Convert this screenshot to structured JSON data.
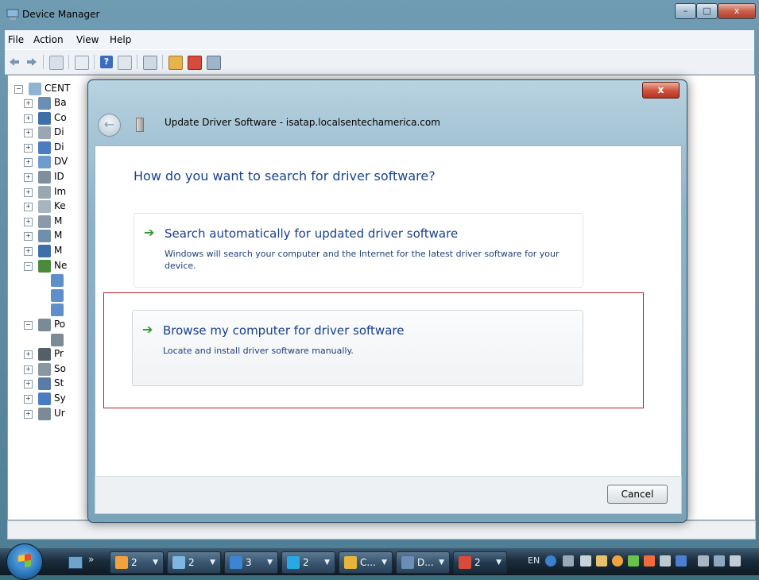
{
  "window": {
    "title": "Device Manager",
    "menu": [
      "File",
      "Action",
      "View",
      "Help"
    ]
  },
  "tree": {
    "root": "CENT",
    "items": [
      {
        "label": "Ba",
        "expander": "+"
      },
      {
        "label": "Co",
        "expander": "+"
      },
      {
        "label": "Di",
        "expander": "+"
      },
      {
        "label": "Di",
        "expander": "+"
      },
      {
        "label": "DV",
        "expander": "+"
      },
      {
        "label": "ID",
        "expander": "+"
      },
      {
        "label": "Im",
        "expander": "+"
      },
      {
        "label": "Ke",
        "expander": "+"
      },
      {
        "label": "M",
        "expander": "+"
      },
      {
        "label": "M",
        "expander": "+"
      },
      {
        "label": "M",
        "expander": "+"
      },
      {
        "label": "Ne",
        "expander": "−"
      },
      {
        "label": "",
        "expander": ""
      },
      {
        "label": "",
        "expander": ""
      },
      {
        "label": "",
        "expander": ""
      },
      {
        "label": "Po",
        "expander": "−"
      },
      {
        "label": "",
        "expander": ""
      },
      {
        "label": "Pr",
        "expander": "+"
      },
      {
        "label": "So",
        "expander": "+"
      },
      {
        "label": "St",
        "expander": "+"
      },
      {
        "label": "Sy",
        "expander": "+"
      },
      {
        "label": "Ur",
        "expander": "+"
      }
    ]
  },
  "dialog": {
    "title": "Update Driver Software - isatap.localsentechamerica.com",
    "question": "How do you want to search for driver software?",
    "option1": {
      "title": "Search automatically for updated driver software",
      "desc": "Windows will search your computer and the Internet for the latest driver software for your device."
    },
    "option2": {
      "title": "Browse my computer for driver software",
      "desc": "Locate and install driver software manually."
    },
    "cancel": "Cancel",
    "close_glyph": "x",
    "back_glyph": "←",
    "arrow_glyph": "➔"
  },
  "taskbar": {
    "buttons": [
      {
        "label": "2",
        "icon_color": "#f0a23c"
      },
      {
        "label": "2",
        "icon_color": "#7fb6e2"
      },
      {
        "label": "3",
        "icon_color": "#3c84d4"
      },
      {
        "label": "2",
        "icon_color": "#27a9e1"
      },
      {
        "label": "C...",
        "icon_color": "#e6b53a"
      },
      {
        "label": "D...",
        "icon_color": "#6a8eb5"
      },
      {
        "label": "2",
        "icon_color": "#d84a3a"
      }
    ],
    "lang": "EN",
    "chevron": "»",
    "dropdown_glyph": "▼"
  },
  "colors": {
    "accent_blue": "#17448f",
    "link_blue": "#1a3e8c",
    "highlight_red": "#b4232d",
    "arrow_green": "#2e9b2a"
  },
  "icons": {
    "title": "device-manager-icon",
    "toolbar": [
      "back-arrow-icon",
      "forward-arrow-icon",
      "properties-icon",
      "view-icon",
      "help-icon",
      "grid-icon",
      "scan-icon",
      "update-driver-icon",
      "disable-icon",
      "uninstall-icon"
    ]
  }
}
